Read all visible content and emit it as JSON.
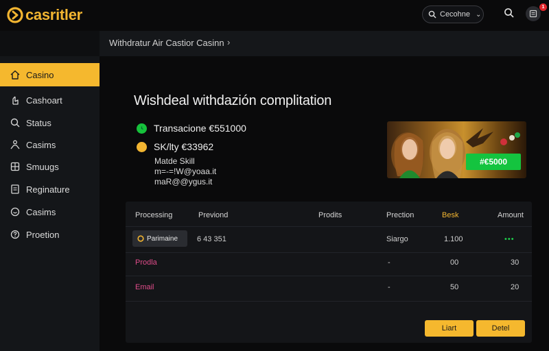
{
  "brand": {
    "name": "casritler",
    "accent": "#f5b82e"
  },
  "header": {
    "search_value": "Cecohne",
    "notification_count": "1"
  },
  "breadcrumb": {
    "label": "Withdratur Air Castior Casinn"
  },
  "sidebar": {
    "items": [
      {
        "label": "Casino",
        "icon": "home-icon",
        "active": true
      },
      {
        "label": "Cashoart",
        "icon": "hand-icon"
      },
      {
        "label": "Status",
        "icon": "search-icon"
      },
      {
        "label": "Casims",
        "icon": "person-icon"
      },
      {
        "label": "Smuugs",
        "icon": "grid-icon"
      },
      {
        "label": "Reginature",
        "icon": "document-icon"
      },
      {
        "label": "Casims",
        "icon": "chat-icon"
      },
      {
        "label": "Proetion",
        "icon": "help-icon"
      }
    ]
  },
  "main": {
    "title": "Wishdeal withdazión complitation",
    "transactions": [
      {
        "text": "Transacione €551000",
        "status_color": "#16c13b"
      },
      {
        "text": "SK/lty €33962",
        "status_color": "#f2b531"
      }
    ],
    "details": [
      "Matde Skill",
      "m=-=!W@yoaa.it",
      "maR@@ygus.it"
    ],
    "promo": {
      "cta": "#€5000"
    }
  },
  "table": {
    "headers": [
      "Processing",
      "Previond",
      "Prodits",
      "Prection",
      "Besk",
      "Amount"
    ],
    "rows": [
      {
        "method": "Parimaine",
        "ref": "6 43 351",
        "status": "Siargo",
        "besk": "1.100",
        "amount": "•••"
      },
      {
        "label": "Prodla",
        "status": "-",
        "besk": "00",
        "amount": "30"
      },
      {
        "label": "Email",
        "status": "-",
        "besk": "50",
        "amount": "20"
      }
    ]
  },
  "actions": {
    "primary": "Liart",
    "secondary": "Detel"
  }
}
